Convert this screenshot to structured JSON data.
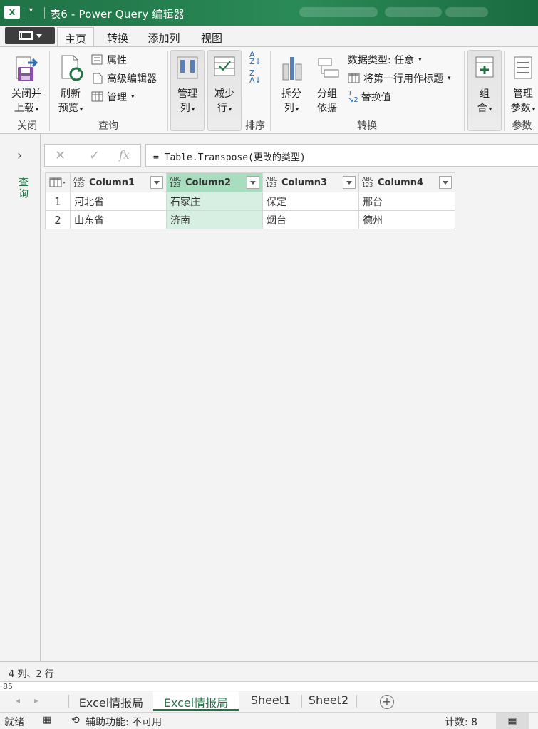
{
  "window": {
    "app_icon": "X",
    "title": "表6 - Power Query 编辑器"
  },
  "tabs": [
    "主页",
    "转换",
    "添加列",
    "视图"
  ],
  "ribbon": {
    "close_load": {
      "line1": "关闭并",
      "line2": "上载"
    },
    "refresh_preview": {
      "line1": "刷新",
      "line2": "预览"
    },
    "properties": "属性",
    "advanced_editor": "高级编辑器",
    "manage": "管理",
    "manage_columns": {
      "line1": "管理",
      "line2": "列"
    },
    "reduce_rows": {
      "line1": "减少",
      "line2": "行"
    },
    "split_column": {
      "line1": "拆分",
      "line2": "列"
    },
    "group_by": {
      "line1": "分组",
      "line2": "依据"
    },
    "data_type": "数据类型: 任意",
    "use_first_row": "将第一行用作标题",
    "replace_values": "替换值",
    "combine": {
      "line1": "组",
      "line2": "合"
    },
    "manage_params": {
      "line1": "管理",
      "line2": "参数"
    },
    "group_labels": {
      "close": "关闭",
      "query": "查询",
      "sort": "排序",
      "transform": "转换",
      "params": "参数"
    }
  },
  "side_panel": {
    "label": "查询"
  },
  "formula_bar": {
    "fx": "fx",
    "formula": "= Table.Transpose(更改的类型)"
  },
  "grid": {
    "columns": [
      {
        "type": "ABC\n123",
        "name": "Column1"
      },
      {
        "type": "ABC\n123",
        "name": "Column2"
      },
      {
        "type": "ABC\n123",
        "name": "Column3"
      },
      {
        "type": "ABC\n123",
        "name": "Column4"
      }
    ],
    "rows": [
      {
        "num": "1",
        "cells": [
          "河北省",
          "石家庄",
          "保定",
          "邢台"
        ]
      },
      {
        "num": "2",
        "cells": [
          "山东省",
          "济南",
          "烟台",
          "德州"
        ]
      }
    ],
    "selected_column": 2
  },
  "status_info": "4 列、2 行",
  "excel_row_hint": "85",
  "sheet_tabs": [
    "Excel情报局",
    "Excel情报局",
    "Sheet1",
    "Sheet2"
  ],
  "active_sheet": 2,
  "statusbar": {
    "ready": "就绪",
    "accessibility": "辅助功能: 不可用",
    "count": "计数: 8"
  },
  "colors": {
    "excel_green": "#217346",
    "selected_header": "#a8ddbf",
    "selected_cell": "#d6efe2"
  }
}
